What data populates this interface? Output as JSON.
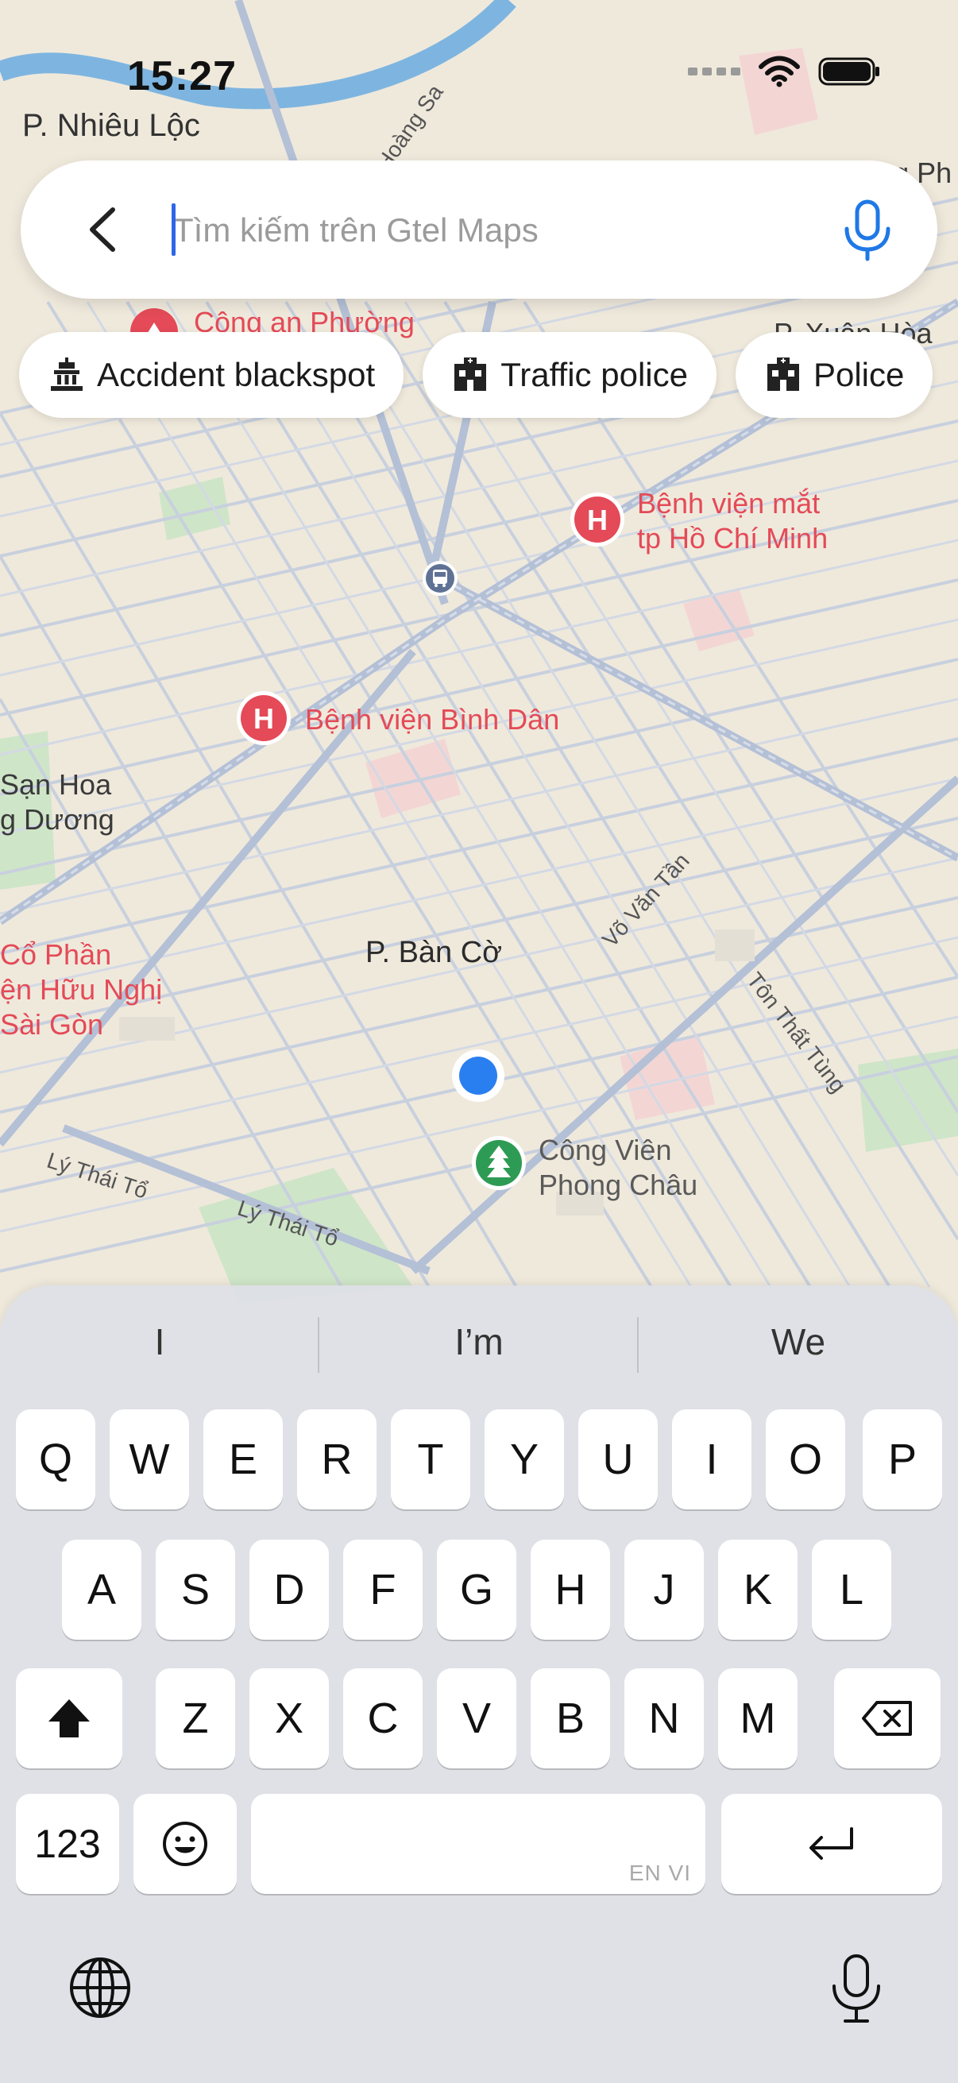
{
  "status_bar": {
    "time": "15:27"
  },
  "map": {
    "ward_top": "P. Nhiêu Lộc",
    "pois": [
      {
        "id": "police_station",
        "label": "Công an Phường"
      },
      {
        "id": "eye_hospital",
        "label_line1": "Bệnh viện mắt",
        "label_line2": "tp Hồ Chí Minh"
      },
      {
        "id": "binh_dan",
        "label": "Bệnh viện Bình Dân"
      },
      {
        "id": "park",
        "label_line1": "Công Viên",
        "label_line2": "Phong Châu"
      },
      {
        "id": "huu_nghi",
        "label_line1": "Cổ Phần",
        "label_line2": "ện Hữu Nghị",
        "label_line3": "Sài Gòn"
      },
      {
        "id": "san_hoa",
        "label_line1": "Sạn Hoa",
        "label_line2": "g Dương"
      }
    ],
    "ward_center": "P. Bàn Cờ",
    "ward_top_right": "P. Xuân Hòa",
    "ward_far_right": "Bảo tàng Ph",
    "streets": {
      "ly_thai_to_1": "Lý Thái Tổ",
      "ly_thai_to_2": "Lý Thái Tổ",
      "vo_van_tan": "Võ Văn Tần",
      "ton_that_tung": "Tôn Thất Tùng",
      "hoang_sa": "Hoàng Sa"
    }
  },
  "search": {
    "placeholder": "Tìm kiếm trên Gtel Maps",
    "value": ""
  },
  "chips": [
    {
      "label": "Accident blackspot",
      "icon": "monument-icon"
    },
    {
      "label": "Traffic police",
      "icon": "police-building-icon"
    },
    {
      "label": "Police",
      "icon": "police-building-icon"
    }
  ],
  "keyboard": {
    "suggestions": [
      "I",
      "I’m",
      "We"
    ],
    "row1": [
      "Q",
      "W",
      "E",
      "R",
      "T",
      "Y",
      "U",
      "I",
      "O",
      "P"
    ],
    "row2": [
      "A",
      "S",
      "D",
      "F",
      "G",
      "H",
      "J",
      "K",
      "L"
    ],
    "row3": [
      "Z",
      "X",
      "C",
      "V",
      "B",
      "N",
      "M"
    ],
    "numbers_label": "123",
    "space_lang": "EN VI"
  },
  "colors": {
    "accent": "#2f66e8",
    "poi_red": "#e44a57",
    "park_green": "#2e9b54",
    "location_blue": "#2a7ff0",
    "map_bg": "#efe9dc"
  }
}
